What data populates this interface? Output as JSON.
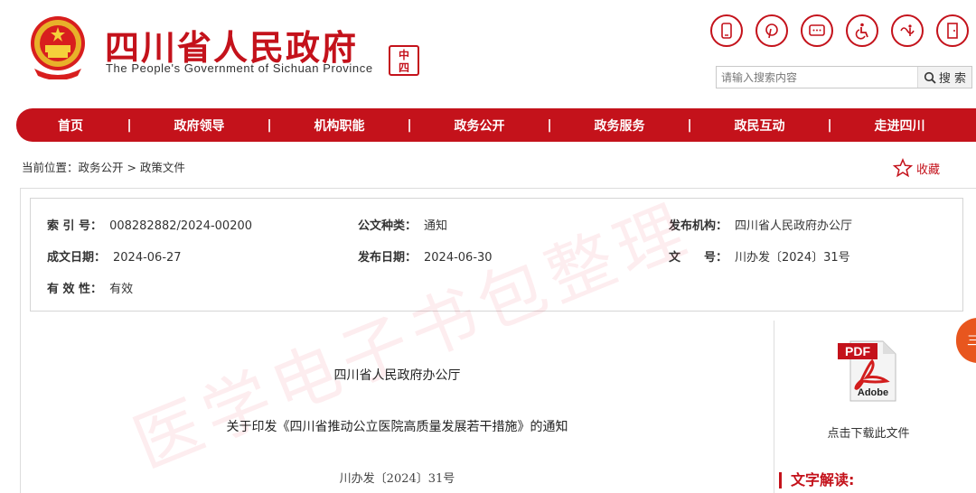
{
  "header": {
    "title": "四川省人民政府",
    "subtitle": "The People's Government of Sichuan Province",
    "seal_text": "中国四川",
    "tool_icons": [
      "mobile-icon",
      "pinterest-icon",
      "message-icon",
      "accessibility-icon",
      "elderly-icon",
      "exit-icon"
    ]
  },
  "search": {
    "placeholder": "请输入搜索内容",
    "button_label": "搜 索"
  },
  "nav": {
    "items": [
      "首页",
      "政府领导",
      "机构职能",
      "政务公开",
      "政务服务",
      "政民互动",
      "走进四川"
    ],
    "separator": "|"
  },
  "breadcrumb": {
    "text": "当前位置：政务公开 > 政策文件"
  },
  "favorite": {
    "label": "收藏"
  },
  "info": {
    "index_label": "索 引 号：",
    "index_value": "008282882/2024-00200",
    "type_label": "公文种类：",
    "type_value": "通知",
    "org_label": "发布机构：",
    "org_value": "四川省人民政府办公厅",
    "written_label": "成文日期：",
    "written_value": "2024-06-27",
    "published_label": "发布日期：",
    "published_value": "2024-06-30",
    "number_label": "文　　号：",
    "number_value": "川办发〔2024〕31号",
    "validity_label": "有 效 性：",
    "validity_value": "有效"
  },
  "document": {
    "issuer": "四川省人民政府办公厅",
    "title": "关于印发《四川省推动公立医院高质量发展若干措施》的通知",
    "number": "川办发〔2024〕31号"
  },
  "sidebar": {
    "download_label": "点击下载此文件",
    "interpretation_label": "文字解读:",
    "pdf_text": "PDF",
    "adobe_text": "Adobe"
  },
  "watermark": "医学电子书包整理",
  "side_float_text": "三",
  "colors": {
    "brand_red": "#c4121b",
    "float_orange": "#e8561e"
  }
}
